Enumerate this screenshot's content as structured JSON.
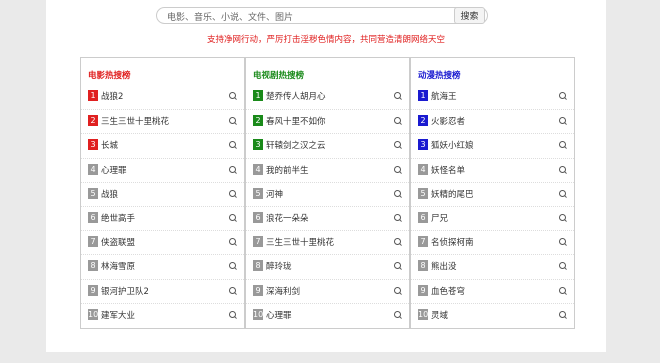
{
  "search": {
    "placeholder": "电影、音乐、小说、文件、图片",
    "button": "搜索"
  },
  "notice": "支持净网行动，严厉打击淫秽色情内容，共同营造清朗网络天空",
  "colors": {
    "gray": "#999999",
    "notice": "#e02020"
  },
  "panels": [
    {
      "title": "电影热搜榜",
      "title_color": "#e02020",
      "top_color": "#e02020",
      "items": [
        "战狼2",
        "三生三世十里桃花",
        "长城",
        "心理罪",
        "战狼",
        "绝世高手",
        "侠盗联盟",
        "林海雪原",
        "银河护卫队2",
        "建军大业"
      ]
    },
    {
      "title": "电视剧热搜榜",
      "title_color": "#1a8a1a",
      "top_color": "#1a8a1a",
      "items": [
        "楚乔传人胡月心",
        "春风十里不如你",
        "轩辕剑之汉之云",
        "我的前半生",
        "河神",
        "浪花一朵朵",
        "三生三世十里桃花",
        "醉玲珑",
        "深海利剑",
        "心理罪"
      ]
    },
    {
      "title": "动漫热搜榜",
      "title_color": "#1a1ad0",
      "top_color": "#1a1ad0",
      "items": [
        "航海王",
        "火影忍者",
        "狐妖小红娘",
        "妖怪名单",
        "妖精的尾巴",
        "尸兄",
        "名侦探柯南",
        "熊出没",
        "血色苍穹",
        "灵域"
      ]
    }
  ]
}
